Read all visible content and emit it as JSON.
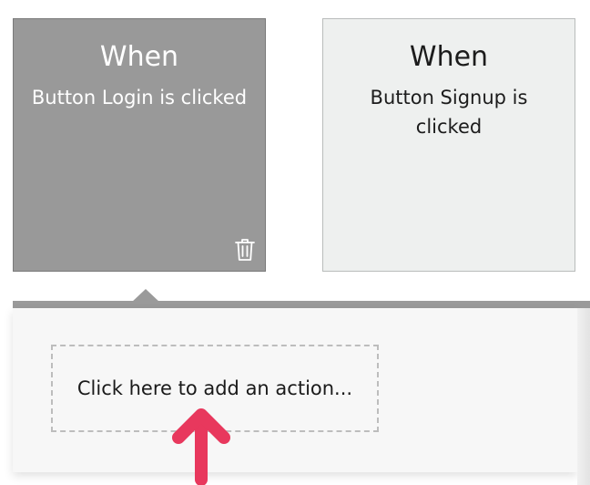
{
  "events": [
    {
      "title": "When",
      "description": "Button Login is clicked",
      "selected": true,
      "delete_icon": "trash-icon"
    },
    {
      "title": "When",
      "description": "Button Signup is clicked",
      "selected": false
    }
  ],
  "action_panel": {
    "add_action_label": "Click here to add an action...",
    "pointer_icon": "arrow-up-icon"
  },
  "colors": {
    "selected_card": "#999999",
    "unselected_card": "#eef0ef",
    "panel_bar": "#9a9a9a",
    "panel_bg": "#f7f7f7",
    "arrow": "#e8385d"
  }
}
